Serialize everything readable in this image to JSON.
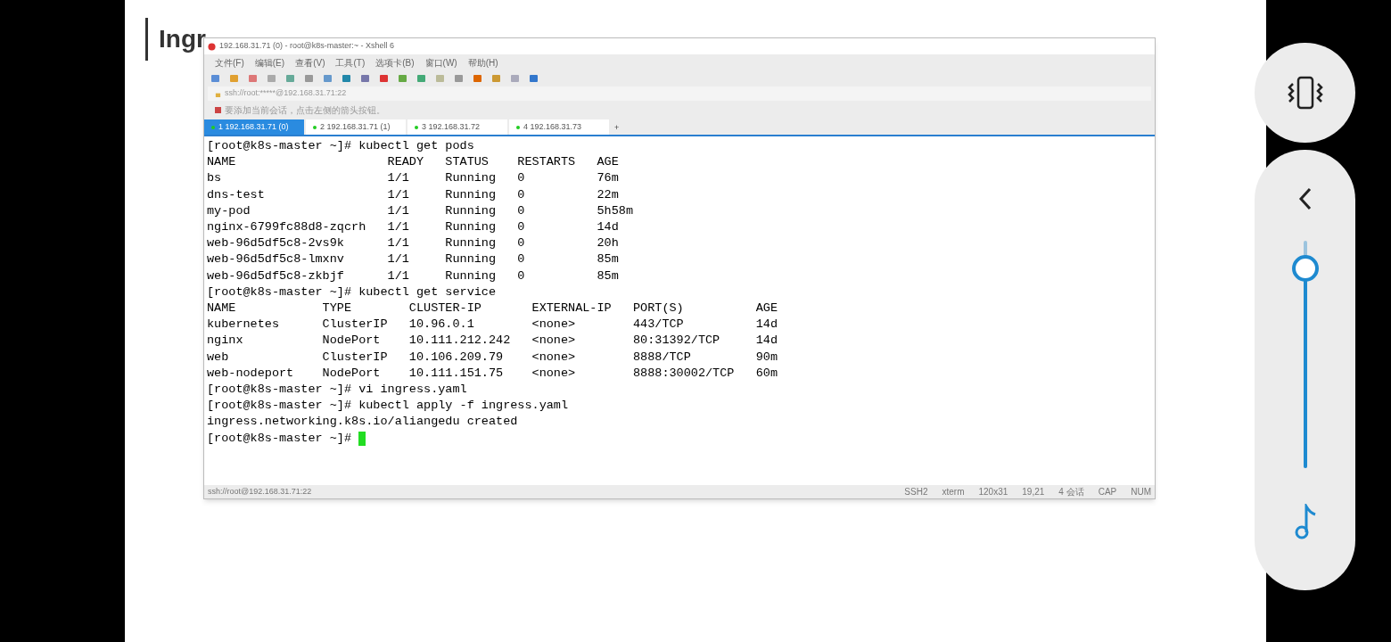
{
  "slide": {
    "title": "Ingr"
  },
  "window": {
    "title": "192.168.31.71 (0) - root@k8s-master:~ - Xshell 6",
    "menu": [
      "文件(F)",
      "编辑(E)",
      "查看(V)",
      "工具(T)",
      "选项卡(B)",
      "窗口(W)",
      "帮助(H)"
    ],
    "address": "ssh://root:*****@192.168.31.71:22",
    "hint": "要添加当前会话，点击左侧的箭头按钮。",
    "tabs": [
      {
        "label": "1 192.168.31.71 (0)",
        "selected": true
      },
      {
        "label": "2 192.168.31.71 (1)",
        "selected": false
      },
      {
        "label": "3 192.168.31.72",
        "selected": false
      },
      {
        "label": "4 192.168.31.73",
        "selected": false
      }
    ],
    "new_tab": "+",
    "terminal": {
      "lines": [
        "[root@k8s-master ~]# kubectl get pods",
        "NAME                     READY   STATUS    RESTARTS   AGE",
        "bs                       1/1     Running   0          76m",
        "dns-test                 1/1     Running   0          22m",
        "my-pod                   1/1     Running   0          5h58m",
        "nginx-6799fc88d8-zqcrh   1/1     Running   0          14d",
        "web-96d5df5c8-2vs9k      1/1     Running   0          20h",
        "web-96d5df5c8-lmxnv      1/1     Running   0          85m",
        "web-96d5df5c8-zkbjf      1/1     Running   0          85m",
        "[root@k8s-master ~]# kubectl get service",
        "NAME            TYPE        CLUSTER-IP       EXTERNAL-IP   PORT(S)          AGE",
        "kubernetes      ClusterIP   10.96.0.1        <none>        443/TCP          14d",
        "nginx           NodePort    10.111.212.242   <none>        80:31392/TCP     14d",
        "web             ClusterIP   10.106.209.79    <none>        8888/TCP         90m",
        "web-nodeport    NodePort    10.111.151.75    <none>        8888:30002/TCP   60m",
        "[root@k8s-master ~]# vi ingress.yaml",
        "[root@k8s-master ~]# kubectl apply -f ingress.yaml",
        "ingress.networking.k8s.io/aliangedu created",
        "[root@k8s-master ~]# "
      ]
    },
    "status_bar": {
      "left": "ssh://root@192.168.31.71:22",
      "items": [
        "SSH2",
        "xterm",
        "120x31",
        "19,21",
        "4 会话",
        "CAP",
        "NUM"
      ]
    }
  },
  "controls": {
    "volume": {
      "level": 0.88
    }
  }
}
